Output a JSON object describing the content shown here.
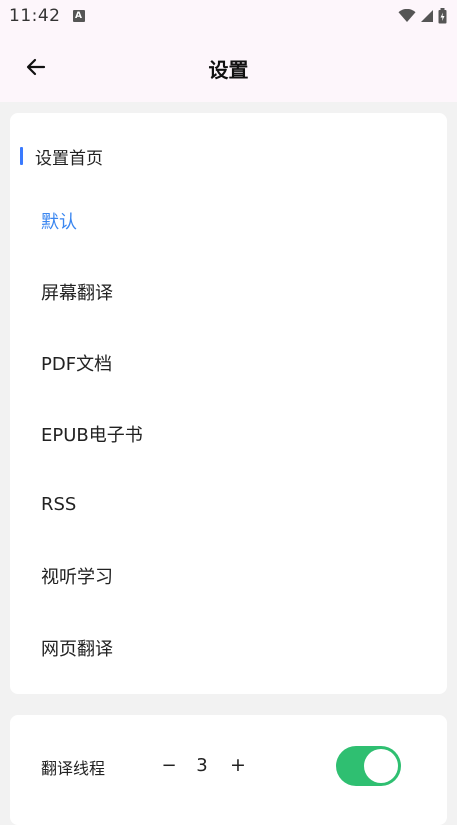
{
  "status_bar": {
    "time": "11:42",
    "notification_icon": "a-icon",
    "icons": [
      "wifi-icon",
      "signal-icon",
      "battery-icon"
    ]
  },
  "app_bar": {
    "back_icon": "arrow-left-icon",
    "title": "设置"
  },
  "home_section": {
    "title": "设置首页",
    "accent_color": "#3a7afe",
    "selected_color": "#3a86f0",
    "options": [
      {
        "label": "默认",
        "selected": true
      },
      {
        "label": "屏幕翻译",
        "selected": false
      },
      {
        "label": "PDF文档",
        "selected": false
      },
      {
        "label": "EPUB电子书",
        "selected": false
      },
      {
        "label": "RSS",
        "selected": false
      },
      {
        "label": "视听学习",
        "selected": false
      },
      {
        "label": "网页翻译",
        "selected": false
      }
    ]
  },
  "thread_section": {
    "label": "翻译线程",
    "minus_label": "−",
    "value": "3",
    "plus_label": "+",
    "toggle_on": true,
    "toggle_color": "#2fbf71"
  }
}
